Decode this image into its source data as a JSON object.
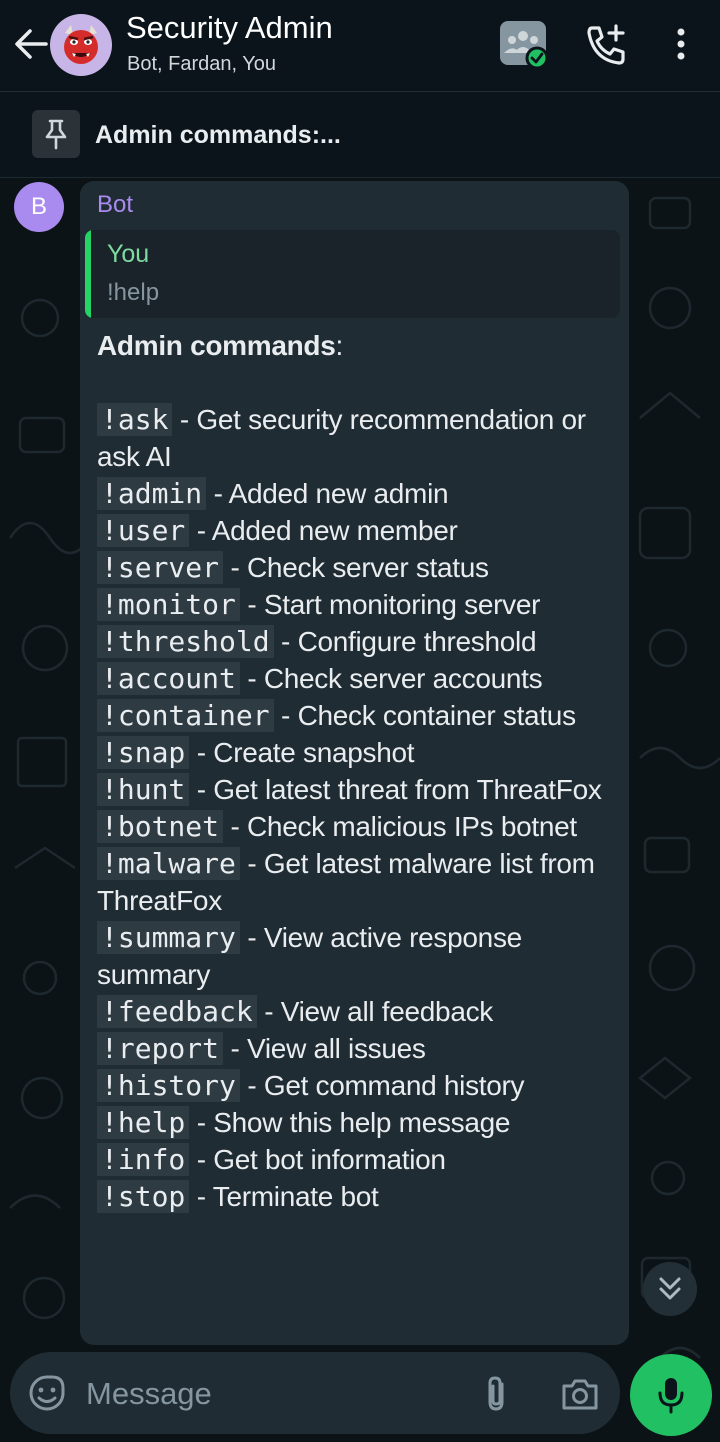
{
  "header": {
    "title": "Security Admin",
    "subtitle": "Bot, Fardan, You",
    "avatar_icon": "ogre-emoji-icon",
    "icons": [
      "back-arrow-icon",
      "community-icon",
      "add-call-icon",
      "more-options-icon"
    ]
  },
  "pinned": {
    "text": "Admin commands:..."
  },
  "message": {
    "sender_initial": "B",
    "sender_name": "Bot",
    "quote": {
      "author": "You",
      "text": "!help"
    },
    "heading": "Admin commands",
    "heading_suffix": ":",
    "commands": [
      {
        "cmd": "!ask",
        "desc": "Get security recommendation or ask AI"
      },
      {
        "cmd": "!admin",
        "desc": "Added new admin"
      },
      {
        "cmd": "!user",
        "desc": "Added new member"
      },
      {
        "cmd": "!server",
        "desc": "Check server status"
      },
      {
        "cmd": "!monitor",
        "desc": "Start monitoring server"
      },
      {
        "cmd": "!threshold",
        "desc": "Configure threshold"
      },
      {
        "cmd": "!account",
        "desc": "Check server accounts"
      },
      {
        "cmd": "!container",
        "desc": "Check container status"
      },
      {
        "cmd": "!snap",
        "desc": "Create snapshot"
      },
      {
        "cmd": "!hunt",
        "desc": "Get latest threat from ThreatFox"
      },
      {
        "cmd": "!botnet",
        "desc": "Check malicious IPs botnet"
      },
      {
        "cmd": "!malware",
        "desc": "Get latest malware list from ThreatFox"
      },
      {
        "cmd": "!summary",
        "desc": "View active response summary"
      },
      {
        "cmd": "!feedback",
        "desc": "View all feedback"
      },
      {
        "cmd": "!report",
        "desc": "View all issues"
      },
      {
        "cmd": "!history",
        "desc": "Get command history"
      },
      {
        "cmd": "!help",
        "desc": "Show this help message"
      },
      {
        "cmd": "!info",
        "desc": "Get bot information"
      },
      {
        "cmd": "!stop",
        "desc": "Terminate bot"
      }
    ]
  },
  "composer": {
    "placeholder": "Message",
    "icons": [
      "emoji-sticker-icon",
      "attach-icon",
      "camera-icon",
      "mic-icon"
    ]
  },
  "colors": {
    "background": "#0b141a",
    "bubble": "#202c33",
    "accent_green": "#21c063",
    "sender_purple": "#a98bf0",
    "code_bg": "#2e3b43"
  }
}
